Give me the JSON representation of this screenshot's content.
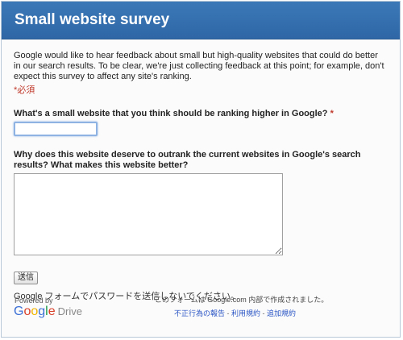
{
  "header": {
    "title": "Small website survey"
  },
  "form": {
    "description": "Google would like to hear feedback about small but high-quality websites that could do better in our search results. To be clear, we're just collecting feedback at this point; for example, don't expect this survey to affect any site's ranking.",
    "required_note": "*必須",
    "q1": {
      "label": "What's a small website that you think should be ranking higher in Google?",
      "star": "*",
      "value": ""
    },
    "q2": {
      "label": "Why does this website deserve to outrank the current websites in Google's search results? What makes this website better?",
      "value": ""
    },
    "submit_label": "送信",
    "password_note": "Google フォームでパスワードを送信しないでください。"
  },
  "footer": {
    "powered_by": "Powered by",
    "logo": {
      "g1": "G",
      "g2": "o",
      "g3": "o",
      "g4": "g",
      "g5": "l",
      "g6": "e",
      "drive": "Drive"
    },
    "created_note": "このフォームは Google.com 内部で作成されました。",
    "links": {
      "report": "不正行為の報告",
      "terms": "利用規約",
      "more": "追加規約",
      "sep": " - "
    }
  },
  "colors": {
    "header_bg": "#3272b0",
    "required": "#c0392b",
    "link": "#2b56c5"
  }
}
